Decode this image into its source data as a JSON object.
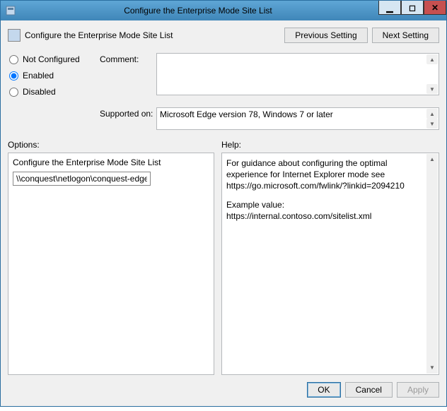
{
  "window": {
    "title": "Configure the Enterprise Mode Site List"
  },
  "header": {
    "title": "Configure the Enterprise Mode Site List"
  },
  "nav": {
    "previous": "Previous Setting",
    "next": "Next Setting"
  },
  "state": {
    "not_configured": "Not Configured",
    "enabled": "Enabled",
    "disabled": "Disabled",
    "selected": "enabled"
  },
  "fields": {
    "comment_label": "Comment:",
    "comment_value": "",
    "supported_label": "Supported on:",
    "supported_value": "Microsoft Edge version 78, Windows 7 or later"
  },
  "sections": {
    "options_label": "Options:",
    "help_label": "Help:"
  },
  "options": {
    "title": "Configure the Enterprise Mode Site List",
    "input_value": "\\\\conquest\\netlogon\\conquest-edge-sit"
  },
  "help": {
    "p1": "For guidance about configuring the optimal experience for Internet Explorer mode see https://go.microsoft.com/fwlink/?linkid=2094210",
    "p2": "Example value: https://internal.contoso.com/sitelist.xml"
  },
  "footer": {
    "ok": "OK",
    "cancel": "Cancel",
    "apply": "Apply"
  }
}
